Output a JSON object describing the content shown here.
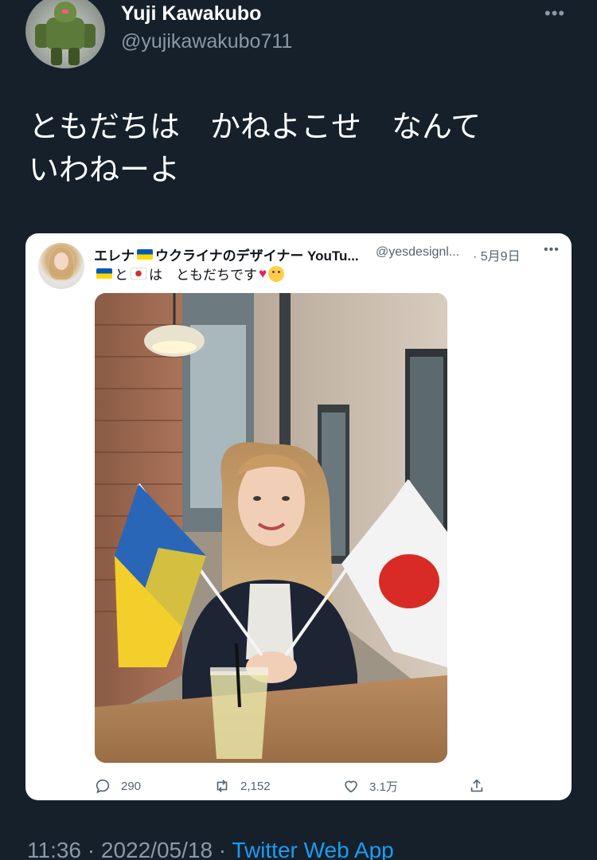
{
  "tweet": {
    "author": {
      "name": "Yuji Kawakubo",
      "handle": "@yujikawakubo711"
    },
    "more_icon": "more-horizontal-icon",
    "text": "ともだちは　かねよこせ　なんて\nいわねーよ"
  },
  "quoted": {
    "name_prefix": "エレナ",
    "name_suffix": " ウクライナのデザイナー YouTu...",
    "handle": "@yesdesignl...",
    "date": "· 5月9日",
    "text_connector": "と",
    "text_main": "は　ともだちです",
    "text_heart": "♥",
    "icons": {
      "flag_ukraine": "flag-ukraine-icon",
      "flag_japan": "flag-japan-icon",
      "heart": "heart-emoji-icon",
      "smile": "smiling-face-hearts-icon"
    },
    "photo": "photo-girl-with-ukraine-and-japan-flags"
  },
  "actions": {
    "reply_count": "290",
    "retweet_count": "2,152",
    "like_count": "3.1万",
    "icons": [
      "reply-icon",
      "retweet-icon",
      "like-icon",
      "share-icon"
    ]
  },
  "footer": {
    "time_date": "11:36 · 2022/05/18 · ",
    "app": "Twitter Web App"
  },
  "colors": {
    "background": "#15202b",
    "secondary_text": "#8b98a5",
    "link": "#1d9bf0",
    "card_background": "#ffffff",
    "card_secondary": "#536471"
  }
}
